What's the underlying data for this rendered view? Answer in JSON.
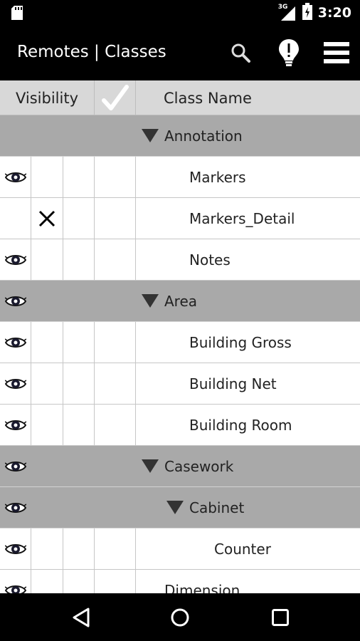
{
  "status_bar": {
    "time": "3:20",
    "network": "3G"
  },
  "app_bar": {
    "title": "Remotes | Classes"
  },
  "table_header": {
    "visibility": "Visibility",
    "class_name": "Class Name"
  },
  "rows": [
    {
      "label": "Annotation",
      "group": true,
      "visible": false,
      "hidden_mark": false,
      "indent": 0
    },
    {
      "label": "Markers",
      "group": false,
      "visible": true,
      "hidden_mark": false,
      "indent": 1
    },
    {
      "label": "Markers_Detail",
      "group": false,
      "visible": false,
      "hidden_mark": true,
      "indent": 1
    },
    {
      "label": "Notes",
      "group": false,
      "visible": true,
      "hidden_mark": false,
      "indent": 1
    },
    {
      "label": "Area",
      "group": true,
      "visible": true,
      "hidden_mark": false,
      "indent": 0
    },
    {
      "label": "Building Gross",
      "group": false,
      "visible": true,
      "hidden_mark": false,
      "indent": 1
    },
    {
      "label": "Building Net",
      "group": false,
      "visible": true,
      "hidden_mark": false,
      "indent": 1
    },
    {
      "label": "Building Room",
      "group": false,
      "visible": true,
      "hidden_mark": false,
      "indent": 1
    },
    {
      "label": "Casework",
      "group": true,
      "visible": true,
      "hidden_mark": false,
      "indent": 0
    },
    {
      "label": "Cabinet",
      "group": true,
      "visible": true,
      "hidden_mark": false,
      "indent": 1
    },
    {
      "label": "Counter",
      "group": false,
      "visible": true,
      "hidden_mark": false,
      "indent": 2
    },
    {
      "label": "Dimension",
      "group": false,
      "visible": true,
      "hidden_mark": false,
      "indent": 0
    }
  ]
}
